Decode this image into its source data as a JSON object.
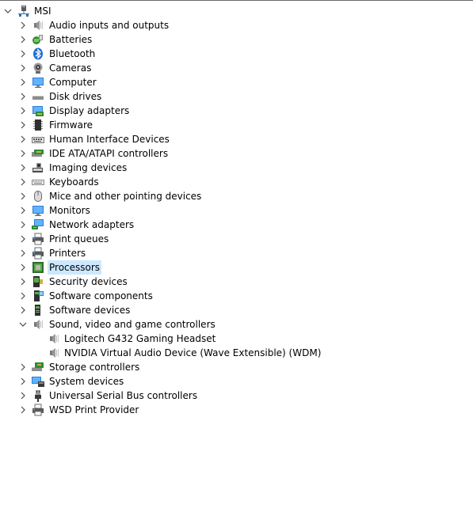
{
  "root": {
    "label": "MSI",
    "icon": "computer-tower-icon",
    "expanded": true
  },
  "categories": [
    {
      "label": "Audio inputs and outputs",
      "icon": "speaker-icon"
    },
    {
      "label": "Batteries",
      "icon": "battery-icon"
    },
    {
      "label": "Bluetooth",
      "icon": "bluetooth-icon"
    },
    {
      "label": "Cameras",
      "icon": "camera-icon"
    },
    {
      "label": "Computer",
      "icon": "monitor-icon"
    },
    {
      "label": "Disk drives",
      "icon": "disk-drive-icon"
    },
    {
      "label": "Display adapters",
      "icon": "display-adapter-icon"
    },
    {
      "label": "Firmware",
      "icon": "chip-icon"
    },
    {
      "label": "Human Interface Devices",
      "icon": "hid-icon"
    },
    {
      "label": "IDE ATA/ATAPI controllers",
      "icon": "ide-controller-icon"
    },
    {
      "label": "Imaging devices",
      "icon": "imaging-icon"
    },
    {
      "label": "Keyboards",
      "icon": "keyboard-icon"
    },
    {
      "label": "Mice and other pointing devices",
      "icon": "mouse-icon"
    },
    {
      "label": "Monitors",
      "icon": "monitor-icon"
    },
    {
      "label": "Network adapters",
      "icon": "network-icon"
    },
    {
      "label": "Print queues",
      "icon": "printer-icon"
    },
    {
      "label": "Printers",
      "icon": "printer-icon"
    },
    {
      "label": "Processors",
      "icon": "processor-icon",
      "selected": true
    },
    {
      "label": "Security devices",
      "icon": "security-icon"
    },
    {
      "label": "Software components",
      "icon": "software-component-icon"
    },
    {
      "label": "Software devices",
      "icon": "software-device-icon"
    },
    {
      "label": "Sound, video and game controllers",
      "icon": "speaker-icon",
      "expanded": true,
      "children": [
        {
          "label": "Logitech G432 Gaming Headset",
          "icon": "speaker-icon"
        },
        {
          "label": "NVIDIA Virtual Audio Device (Wave Extensible) (WDM)",
          "icon": "speaker-icon"
        }
      ]
    },
    {
      "label": "Storage controllers",
      "icon": "storage-controller-icon"
    },
    {
      "label": "System devices",
      "icon": "system-devices-icon"
    },
    {
      "label": "Universal Serial Bus controllers",
      "icon": "usb-icon"
    },
    {
      "label": "WSD Print Provider",
      "icon": "printer-icon"
    }
  ]
}
